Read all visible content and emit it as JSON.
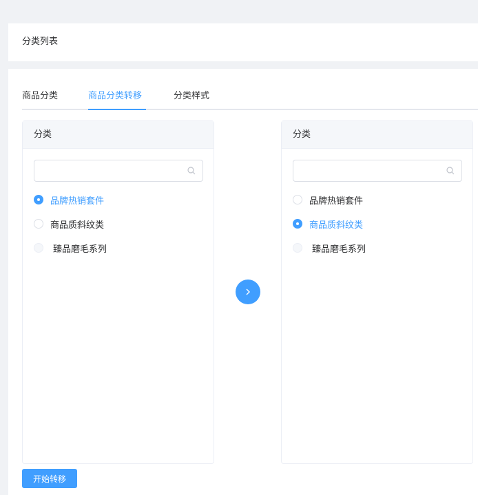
{
  "page": {
    "title": "分类列表"
  },
  "tabs": [
    {
      "label": "商品分类",
      "active": false
    },
    {
      "label": "商品分类转移",
      "active": true
    },
    {
      "label": "分类样式",
      "active": false
    }
  ],
  "left_panel": {
    "header": "分类",
    "search_value": "",
    "options": [
      {
        "label": "品牌热销套件",
        "state": "checked"
      },
      {
        "label": "商品质斜纹类",
        "state": "unchecked"
      },
      {
        "label": "臻品磨毛系列",
        "state": "disabled"
      }
    ]
  },
  "right_panel": {
    "header": "分类",
    "search_value": "",
    "options": [
      {
        "label": "品牌热销套件",
        "state": "unchecked"
      },
      {
        "label": "商品质斜纹类",
        "state": "checked"
      },
      {
        "label": "臻品磨毛系列",
        "state": "disabled"
      }
    ]
  },
  "actions": {
    "start_label": "开始转移"
  },
  "icons": {
    "search": "search-icon",
    "transfer": "chevron-right-icon"
  },
  "colors": {
    "accent": "#409eff",
    "background": "#f0f2f5"
  }
}
